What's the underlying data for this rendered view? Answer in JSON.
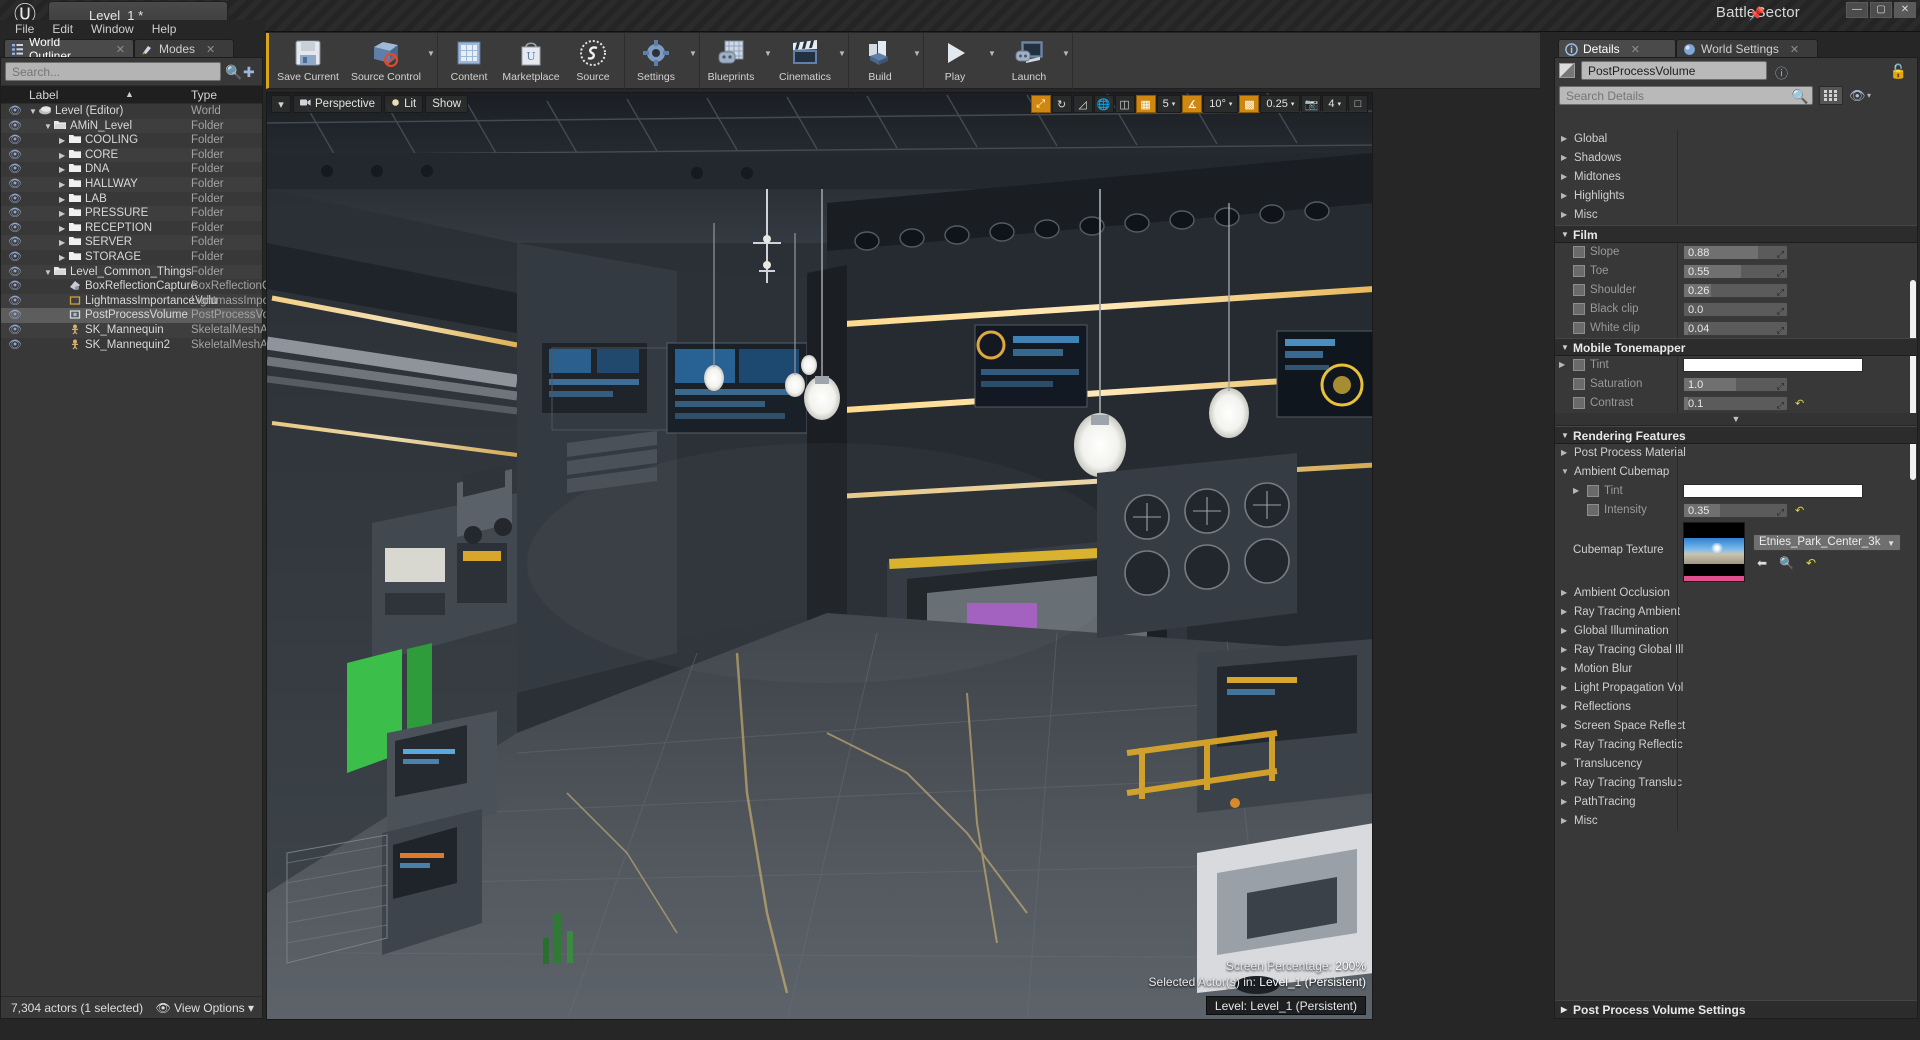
{
  "titlebar": {
    "logo": "unreal-logo",
    "level_tab": "Level_1 *",
    "project": "BattleSector",
    "pin_icon": "pin-icon",
    "minimize": "—",
    "maximize": "▢",
    "close": "✕"
  },
  "menubar": {
    "items": [
      "File",
      "Edit",
      "Window",
      "Help"
    ]
  },
  "toolbar": {
    "groups": [
      {
        "buttons": [
          {
            "label": "Save Current",
            "icon": "floppy-disk-icon",
            "caret": false
          },
          {
            "label": "Source Control",
            "icon": "source-control-icon",
            "caret": true
          }
        ]
      },
      {
        "buttons": [
          {
            "label": "Content",
            "icon": "content-browser-icon",
            "caret": false
          },
          {
            "label": "Marketplace",
            "icon": "marketplace-bag-icon",
            "caret": false
          },
          {
            "label": "Source",
            "icon": "source-s-icon",
            "caret": false
          }
        ]
      },
      {
        "buttons": [
          {
            "label": "Settings",
            "icon": "settings-gear-icon",
            "caret": true
          }
        ]
      },
      {
        "buttons": [
          {
            "label": "Blueprints",
            "icon": "blueprints-icon",
            "caret": true
          },
          {
            "label": "Cinematics",
            "icon": "cinematics-clapper-icon",
            "caret": true
          }
        ]
      },
      {
        "buttons": [
          {
            "label": "Build",
            "icon": "build-blocks-icon",
            "caret": true
          }
        ]
      },
      {
        "buttons": [
          {
            "label": "Play",
            "icon": "play-triangle-icon",
            "caret": true
          },
          {
            "label": "Launch",
            "icon": "launch-device-icon",
            "caret": true
          }
        ]
      }
    ]
  },
  "left_panel": {
    "tabs": [
      {
        "label": "World Outliner",
        "icon": "outliner-list-icon",
        "active": true,
        "closable": true
      },
      {
        "label": "Modes",
        "icon": "modes-brush-icon",
        "active": false,
        "closable": true
      }
    ],
    "search": {
      "placeholder": "Search...",
      "value": "",
      "icon": "search-icon",
      "add_icon": "add-filter-icon"
    },
    "columns": {
      "label": "Label",
      "type": "Type"
    },
    "rows": [
      {
        "label": "Level (Editor)",
        "type": "World",
        "indent": 0,
        "tri": "down",
        "icon": "world-icon",
        "selected": false
      },
      {
        "label": "AMiN_Level",
        "type": "Folder",
        "indent": 1,
        "tri": "down",
        "icon": "folder-open-icon",
        "selected": false
      },
      {
        "label": "COOLING",
        "type": "Folder",
        "indent": 2,
        "tri": "right",
        "icon": "folder-icon",
        "selected": false
      },
      {
        "label": "CORE",
        "type": "Folder",
        "indent": 2,
        "tri": "right",
        "icon": "folder-icon",
        "selected": false
      },
      {
        "label": "DNA",
        "type": "Folder",
        "indent": 2,
        "tri": "right",
        "icon": "folder-icon",
        "selected": false
      },
      {
        "label": "HALLWAY",
        "type": "Folder",
        "indent": 2,
        "tri": "right",
        "icon": "folder-icon",
        "selected": false
      },
      {
        "label": "LAB",
        "type": "Folder",
        "indent": 2,
        "tri": "right",
        "icon": "folder-icon",
        "selected": false
      },
      {
        "label": "PRESSURE",
        "type": "Folder",
        "indent": 2,
        "tri": "right",
        "icon": "folder-icon",
        "selected": false
      },
      {
        "label": "RECEPTION",
        "type": "Folder",
        "indent": 2,
        "tri": "right",
        "icon": "folder-icon",
        "selected": false
      },
      {
        "label": "SERVER",
        "type": "Folder",
        "indent": 2,
        "tri": "right",
        "icon": "folder-icon",
        "selected": false
      },
      {
        "label": "STORAGE",
        "type": "Folder",
        "indent": 2,
        "tri": "right",
        "icon": "folder-icon",
        "selected": false
      },
      {
        "label": "Level_Common_Things",
        "type": "Folder",
        "indent": 1,
        "tri": "down",
        "icon": "folder-open-icon",
        "selected": false
      },
      {
        "label": "BoxReflectionCapture",
        "type": "BoxReflectionC",
        "indent": 2,
        "tri": "none",
        "icon": "reflection-capture-icon",
        "selected": false
      },
      {
        "label": "LightmassImportanceVolu",
        "type": "LightmassImpo",
        "indent": 2,
        "tri": "none",
        "icon": "volume-icon",
        "selected": false
      },
      {
        "label": "PostProcessVolume",
        "type": "PostProcessVo",
        "indent": 2,
        "tri": "none",
        "icon": "postprocess-icon",
        "selected": true
      },
      {
        "label": "SK_Mannequin",
        "type": "SkeletalMeshAc",
        "indent": 2,
        "tri": "none",
        "icon": "skeletal-mesh-icon",
        "selected": false
      },
      {
        "label": "SK_Mannequin2",
        "type": "SkeletalMeshAc",
        "indent": 2,
        "tri": "none",
        "icon": "skeletal-mesh-icon",
        "selected": false
      }
    ],
    "footer": {
      "count": "7,304 actors (1 selected)",
      "view_options": "View Options",
      "eye_icon": "eye-icon",
      "caret": "▾"
    }
  },
  "viewport": {
    "left_buttons": [
      {
        "label": "Perspective",
        "icon": "camera-icon"
      },
      {
        "label": "Lit",
        "icon": "lit-icon"
      },
      {
        "label": "Show",
        "icon": "show-icon"
      }
    ],
    "right_controls": [
      {
        "name": "transform-mode-select",
        "icon": "arrow-cursor-icon",
        "active": true
      },
      {
        "name": "transform-mode-rotate",
        "icon": "rotate-icon",
        "active": false
      },
      {
        "name": "transform-mode-scale",
        "icon": "scale-icon",
        "active": false
      },
      {
        "name": "world-space-toggle",
        "icon": "globe-icon",
        "active": false
      },
      {
        "name": "surface-snap-toggle",
        "icon": "surface-snap-icon",
        "active": false
      },
      {
        "name": "grid-snap-toggle",
        "icon": "grid-icon",
        "active": true,
        "value": "5"
      },
      {
        "name": "angle-snap-toggle",
        "icon": "angle-icon",
        "active": true,
        "value": "10°"
      },
      {
        "name": "scale-snap-toggle",
        "icon": "scale-snap-icon",
        "active": true,
        "value": "0.25"
      },
      {
        "name": "camera-speed",
        "icon": "camera-speed-icon",
        "active": false,
        "value": "4"
      },
      {
        "name": "maximize-viewport",
        "icon": "maximize-icon",
        "active": false
      }
    ],
    "status": {
      "screen_percentage_label": "Screen Percentage:",
      "screen_percentage_value": "200%",
      "selected_actors_label": "Selected Actor(s) in:",
      "selected_actors_value": "Level_1 (Persistent)",
      "level_pill": "Level:  Level_1 (Persistent)"
    }
  },
  "details_panel": {
    "tabs": [
      {
        "label": "Details",
        "icon": "details-info-icon",
        "active": true,
        "closable": true
      },
      {
        "label": "World Settings",
        "icon": "world-settings-icon",
        "active": false,
        "closable": true
      }
    ],
    "actor_name": "PostProcessVolume",
    "help_icon": "help-icon",
    "lock_icon": "lock-icon",
    "search": {
      "placeholder": "Search Details",
      "value": "",
      "icon": "search-icon"
    },
    "grid_icon": "grid-view-icon",
    "eye_icon": "eye-icon",
    "top_rows": [
      {
        "label": "Global",
        "arrow": "right"
      },
      {
        "label": "Shadows",
        "arrow": "right"
      },
      {
        "label": "Midtones",
        "arrow": "right"
      },
      {
        "label": "Highlights",
        "arrow": "right"
      },
      {
        "label": "Misc",
        "arrow": "right"
      }
    ],
    "film": {
      "title": "Film",
      "rows": [
        {
          "label": "Slope",
          "value": "0.88",
          "fill_pct": 72,
          "checkbox": true
        },
        {
          "label": "Toe",
          "value": "0.55",
          "fill_pct": 55,
          "checkbox": true
        },
        {
          "label": "Shoulder",
          "value": "0.26",
          "fill_pct": 26,
          "checkbox": true
        },
        {
          "label": "Black clip",
          "value": "0.0",
          "fill_pct": 0,
          "checkbox": true
        },
        {
          "label": "White clip",
          "value": "0.04",
          "fill_pct": 4,
          "checkbox": true
        }
      ]
    },
    "mobile_tonemapper": {
      "title": "Mobile Tonemapper",
      "rows": [
        {
          "label": "Tint",
          "type": "color",
          "arrow": "right",
          "checkbox": true,
          "color": "#ffffff"
        },
        {
          "label": "Saturation",
          "type": "number",
          "value": "1.0",
          "fill_pct": 50,
          "checkbox": true
        },
        {
          "label": "Contrast",
          "type": "number",
          "value": "0.1",
          "fill_pct": 4,
          "checkbox": true,
          "reset": true
        }
      ]
    },
    "rendering_features": {
      "title": "Rendering Features",
      "rows": [
        {
          "label": "Post Process Material",
          "arrow": "right",
          "indent": 0
        },
        {
          "label": "Ambient Cubemap",
          "arrow": "down",
          "indent": 0
        }
      ],
      "ambient_cubemap": {
        "tint": {
          "label": "Tint",
          "arrow": "right",
          "checkbox": true,
          "color": "#ffffff"
        },
        "intensity": {
          "label": "Intensity",
          "value": "0.35",
          "fill_pct": 35,
          "checkbox": true,
          "reset": true
        },
        "cubemap_texture": {
          "label": "Cubemap Texture",
          "asset_name": "Etnies_Park_Center_3k",
          "thumbnail": "cubemap-thumbnail",
          "back_icon": "back-arrow-icon",
          "browse_icon": "browse-icon",
          "reset_icon": "reset-icon"
        }
      },
      "more_rows": [
        {
          "label": "Ambient Occlusion",
          "arrow": "right"
        },
        {
          "label": "Ray Tracing Ambient",
          "arrow": "right"
        },
        {
          "label": "Global Illumination",
          "arrow": "right"
        },
        {
          "label": "Ray Tracing Global Ill",
          "arrow": "right"
        },
        {
          "label": "Motion Blur",
          "arrow": "right"
        },
        {
          "label": "Light Propagation Vol",
          "arrow": "right"
        },
        {
          "label": "Reflections",
          "arrow": "right"
        },
        {
          "label": "Screen Space Reflect",
          "arrow": "right"
        },
        {
          "label": "Ray Tracing Reflectic",
          "arrow": "right"
        },
        {
          "label": "Translucency",
          "arrow": "right"
        },
        {
          "label": "Ray Tracing Transluc",
          "arrow": "right"
        },
        {
          "label": "PathTracing",
          "arrow": "right"
        },
        {
          "label": "Misc",
          "arrow": "right"
        }
      ]
    },
    "bottom_category": "Post Process Volume Settings"
  },
  "colors": {
    "accent_orange": "#d8a41a",
    "panel_bg": "#383838",
    "toolbar_bg": "#3b3b3b",
    "selection": "#5d5d5d",
    "text": "#d9d9d9"
  }
}
